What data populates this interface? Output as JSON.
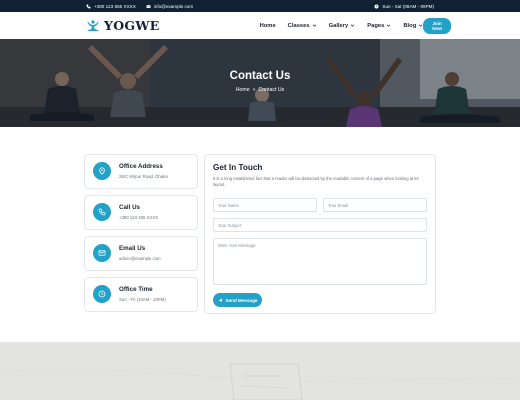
{
  "topbar": {
    "phone": "+380 123 555 XXXX",
    "email": "info@example.com",
    "hours": "Sun - Sat (06AM - 09PM)"
  },
  "header": {
    "brand": "YOGWE",
    "nav": [
      {
        "label": "Home",
        "dropdown": false
      },
      {
        "label": "Classes",
        "dropdown": true
      },
      {
        "label": "Gallery",
        "dropdown": true
      },
      {
        "label": "Pages",
        "dropdown": true
      },
      {
        "label": "Blog",
        "dropdown": true
      }
    ],
    "cta": "Join Now"
  },
  "hero": {
    "title": "Contact Us",
    "breadcrumb": [
      "Home",
      "Contact Us"
    ]
  },
  "info_cards": [
    {
      "icon": "location-pin-icon",
      "title": "Office Address",
      "value": "25/C Mirpur Road, Dhaka"
    },
    {
      "icon": "phone-icon",
      "title": "Call Us",
      "value": "+380 123 455 XXXX"
    },
    {
      "icon": "envelope-icon",
      "title": "Email Us",
      "value": "admin@example.com"
    },
    {
      "icon": "clock-icon",
      "title": "Office Time",
      "value": "Sun - Fri (10AM - 10PM)"
    }
  ],
  "form": {
    "title": "Get In Touch",
    "description": "It is a long established fact that a reader will be distracted by the readable content of a page when looking at its layout.",
    "name_placeholder": "Your Name",
    "email_placeholder": "Your Email",
    "subject_placeholder": "Your Subject",
    "message_placeholder": "Write Your Message",
    "submit": "Send Message"
  },
  "colors": {
    "accent": "#22a2c8",
    "dark": "#0f2133"
  }
}
